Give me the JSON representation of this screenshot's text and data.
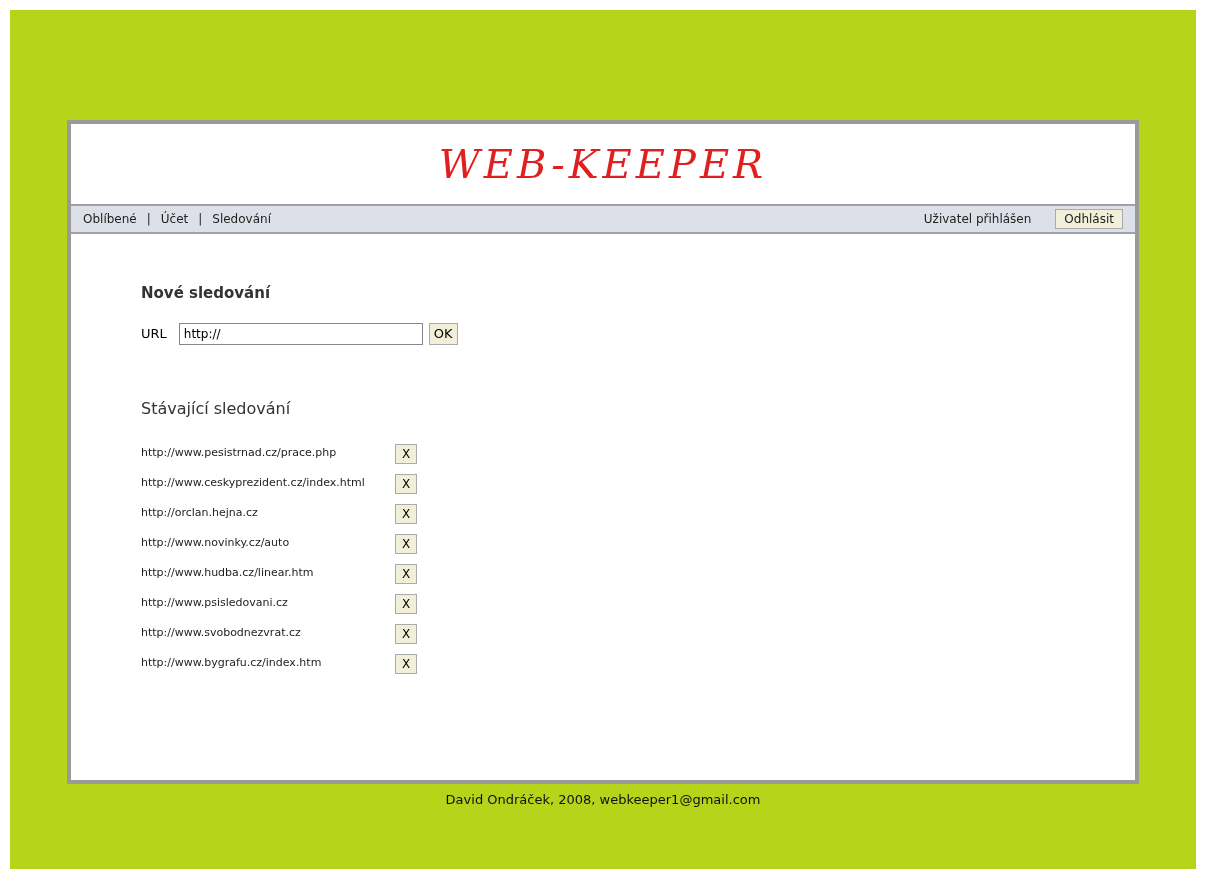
{
  "logo": "WEB-KEEPER",
  "nav": {
    "links": [
      "Oblíbené",
      "Účet",
      "Sledování"
    ],
    "separator": "|",
    "user_status": "Uživatel přihlášen",
    "logout_button": "Odhlásit"
  },
  "new_watch": {
    "title": "Nové sledování",
    "label": "URL",
    "value": "http://",
    "submit": "OK"
  },
  "existing": {
    "title": "Stávající sledování",
    "items": [
      {
        "url": "http://www.pesistrnad.cz/prace.php",
        "delete": "X"
      },
      {
        "url": "http://www.ceskyprezident.cz/index.html",
        "delete": "X"
      },
      {
        "url": "http://orclan.hejna.cz",
        "delete": "X"
      },
      {
        "url": "http://www.novinky.cz/auto",
        "delete": "X"
      },
      {
        "url": "http://www.hudba.cz/linear.htm",
        "delete": "X"
      },
      {
        "url": "http://www.psisledovani.cz",
        "delete": "X"
      },
      {
        "url": "http://www.svobodnezvrat.cz",
        "delete": "X"
      },
      {
        "url": "http://www.bygrafu.cz/index.htm",
        "delete": "X"
      }
    ]
  },
  "footer": "David Ondráček, 2008, webkeeper1@gmail.com"
}
